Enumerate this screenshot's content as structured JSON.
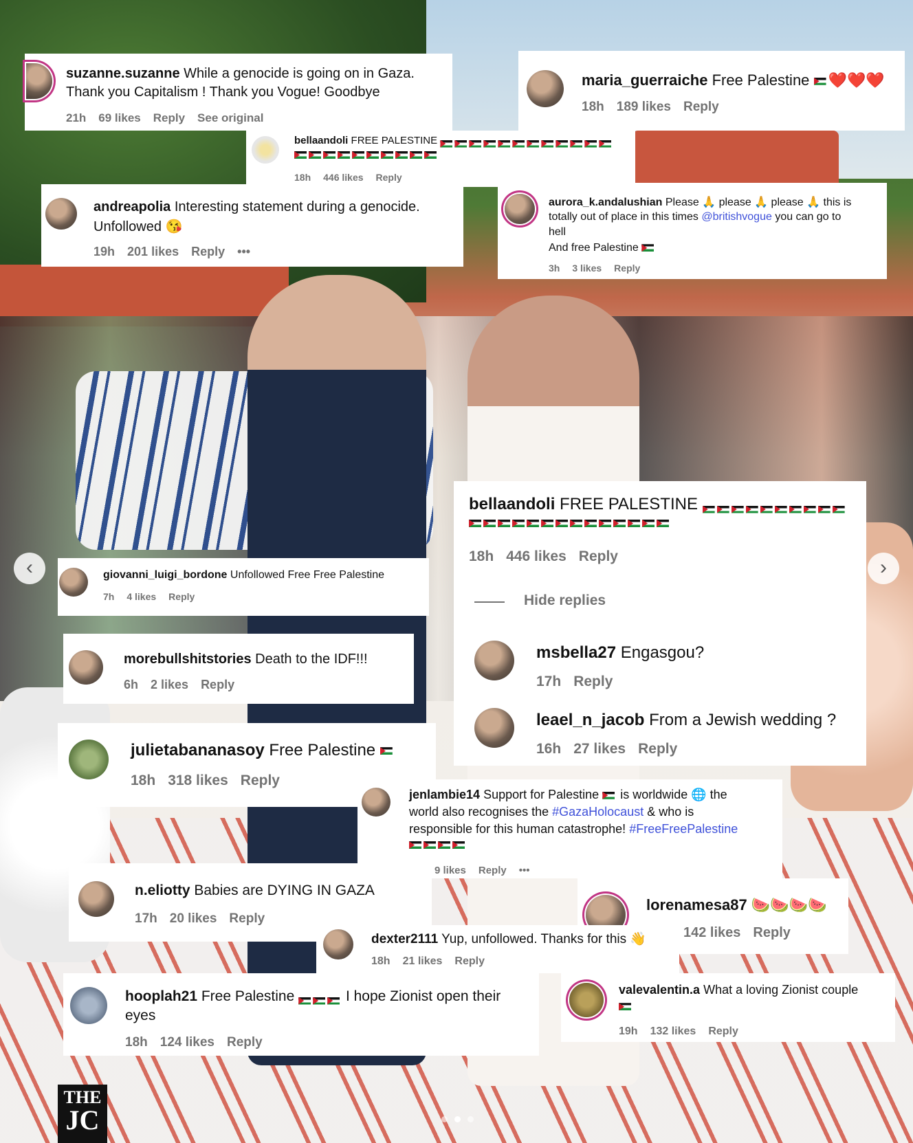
{
  "carousel": {
    "prev_icon": "chevron-left-icon",
    "next_icon": "chevron-right-icon",
    "pages": 3,
    "active_page": 2
  },
  "logo": {
    "line1": "THE",
    "line2": "JC"
  },
  "c1": {
    "user": "suzanne.suzanne",
    "text1": "While a genocide is going on in Gaza.",
    "text2": "Thank you Capitalism ! Thank you Vogue! Goodbye",
    "time": "21h",
    "likes": "69 likes",
    "reply": "Reply",
    "extra": "See original"
  },
  "c2": {
    "user": "maria_guerraiche",
    "text": "Free Palestine",
    "hearts": "❤️❤️❤️",
    "time": "18h",
    "likes": "189 likes",
    "reply": "Reply"
  },
  "c3": {
    "user": "bellaandoli",
    "text": "FREE PALESTINE",
    "time": "18h",
    "likes": "446 likes",
    "reply": "Reply"
  },
  "c4": {
    "user": "andreapolia",
    "text1": "Interesting statement during a genocide.",
    "text2": "Unfollowed 😘",
    "time": "19h",
    "likes": "201 likes",
    "reply": "Reply",
    "more": "•••"
  },
  "c5": {
    "user": "aurora_k.andalushian",
    "text1": "Please 🙏 please 🙏 please 🙏 this is",
    "text2a": "totally out of place in this times",
    "mention": "@britishvogue",
    "text2b": "you can go to",
    "text3": "hell",
    "text4": "And free Palestine",
    "time": "3h",
    "likes": "3 likes",
    "reply": "Reply"
  },
  "c6": {
    "user": "giovanni_luigi_bordone",
    "text": "Unfollowed Free Free Palestine",
    "time": "7h",
    "likes": "4 likes",
    "reply": "Reply"
  },
  "c7": {
    "user": "bellaandoli",
    "text": "FREE PALESTINE",
    "time": "18h",
    "likes": "446 likes",
    "reply": "Reply",
    "hide": "Hide replies",
    "r1": {
      "user": "msbella27",
      "text": "Engasgou?",
      "time": "17h",
      "reply": "Reply"
    },
    "r2": {
      "user": "leael_n_jacob",
      "text": "From a Jewish wedding ?",
      "time": "16h",
      "likes": "27 likes",
      "reply": "Reply"
    }
  },
  "c8": {
    "user": "morebullshitstories",
    "text": "Death to the IDF!!!",
    "time": "6h",
    "likes": "2 likes",
    "reply": "Reply"
  },
  "c9": {
    "user": "julietabananasoy",
    "text": "Free Palestine",
    "time": "18h",
    "likes": "318 likes",
    "reply": "Reply"
  },
  "c10": {
    "user": "jenlambie14",
    "text1a": "Support for Palestine",
    "text1b": "is worldwide 🌐 the",
    "text2a": "world also recognises the",
    "tag1": "#GazaHolocaust",
    "text2b": "& who is",
    "text3a": "responsible for this human catastrophe!",
    "tag2": "#FreeFreePalestine",
    "likes": "9 likes",
    "reply": "Reply",
    "more": "•••"
  },
  "c11": {
    "user": "n.eliotty",
    "text": "Babies are DYING IN GAZA",
    "time": "17h",
    "likes": "20 likes",
    "reply": "Reply"
  },
  "c12": {
    "user": "lorenamesa87",
    "text": "🍉🍉🍉🍉",
    "likes": "142 likes",
    "reply": "Reply"
  },
  "c13": {
    "user": "dexter2111",
    "text": "Yup, unfollowed. Thanks for this 👋",
    "time": "18h",
    "likes": "21 likes",
    "reply": "Reply"
  },
  "c14": {
    "user": "hooplah21",
    "text1a": "Free Palestine",
    "text1b": "I hope Zionist open their",
    "text2": "eyes",
    "time": "18h",
    "likes": "124 likes",
    "reply": "Reply"
  },
  "c15": {
    "user": "valevalentin.a",
    "text": "What a loving Zionist couple",
    "time": "19h",
    "likes": "132 likes",
    "reply": "Reply"
  }
}
